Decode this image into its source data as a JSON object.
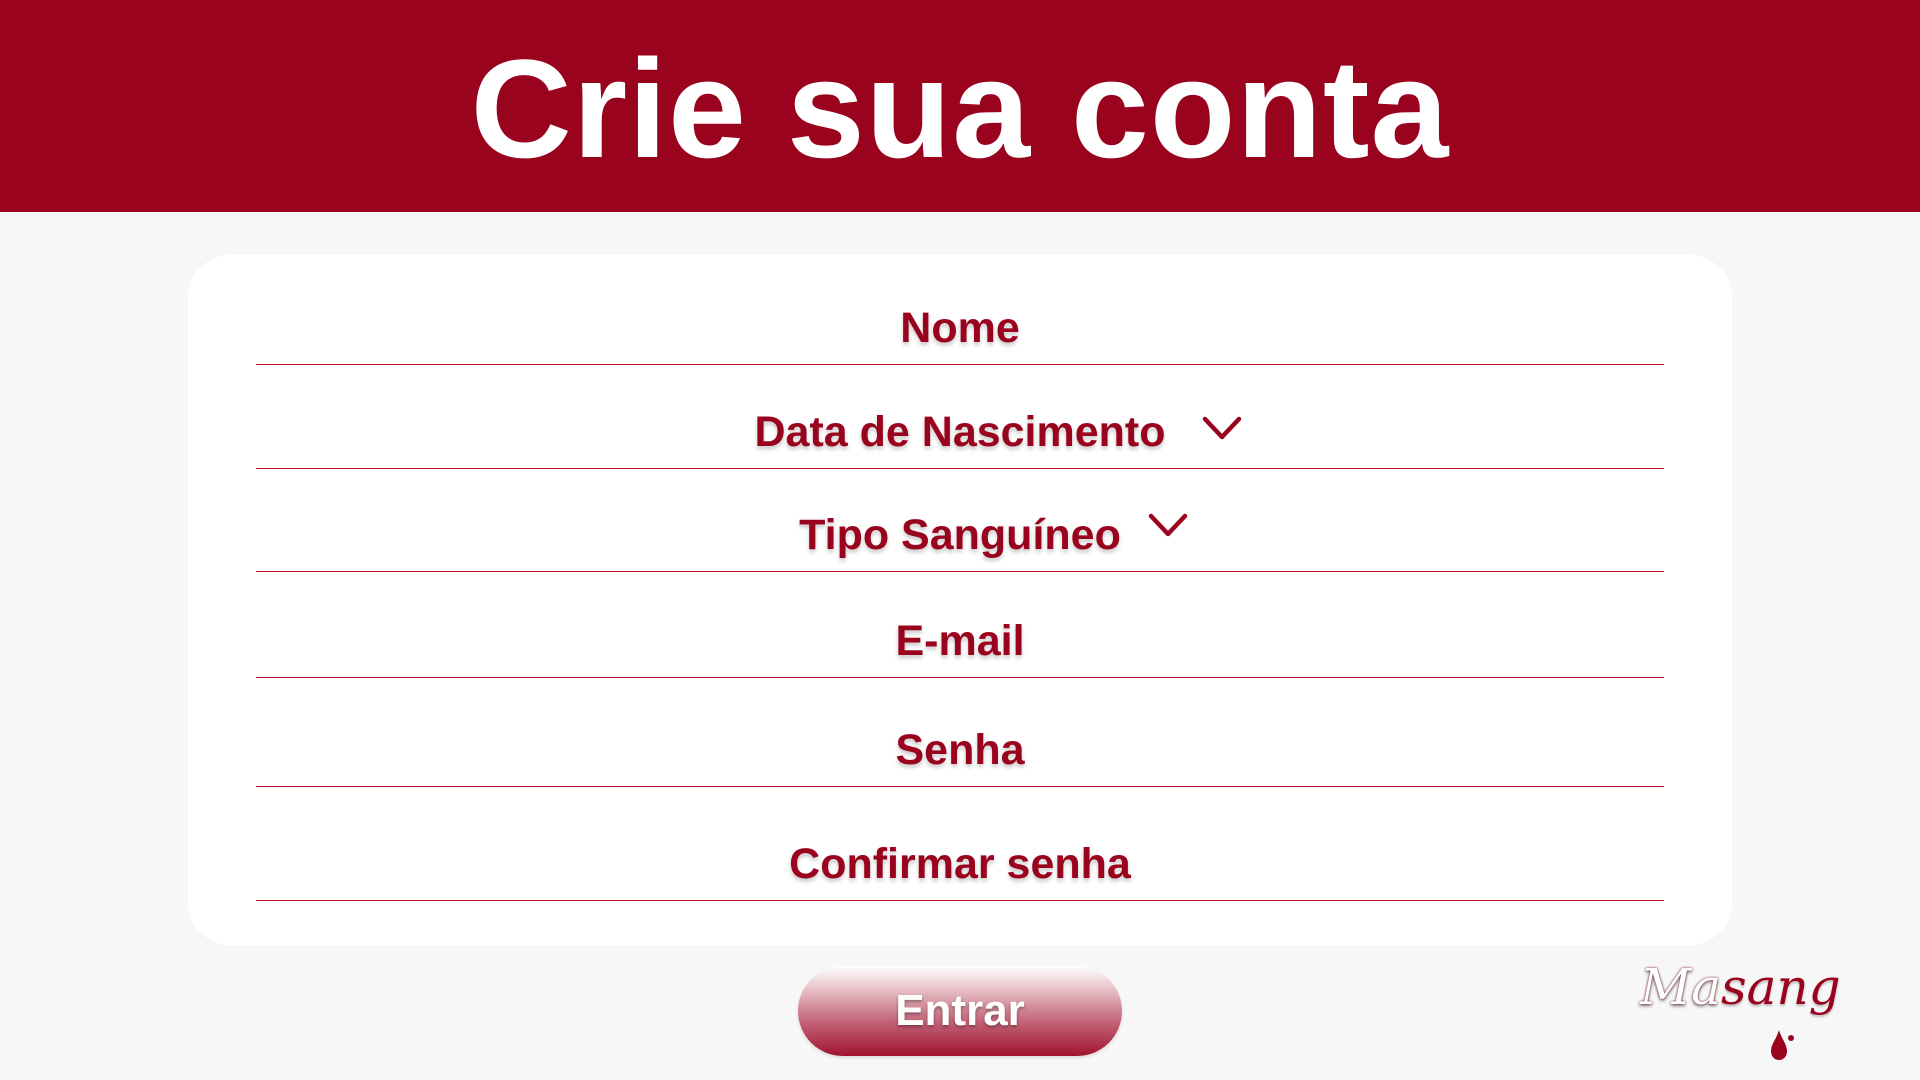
{
  "header": {
    "title": "Crie sua conta"
  },
  "form": {
    "fields": [
      {
        "label": "Nome",
        "type": "text",
        "has_dropdown": false
      },
      {
        "label": "Data de Nascimento",
        "type": "select",
        "has_dropdown": true,
        "icon": "chevron-down-icon"
      },
      {
        "label": "Tipo Sanguíneo",
        "type": "select",
        "has_dropdown": true,
        "icon": "chevron-down-icon"
      },
      {
        "label": "E-mail",
        "type": "email",
        "has_dropdown": false
      },
      {
        "label": "Senha",
        "type": "password",
        "has_dropdown": false
      },
      {
        "label": "Confirmar senha",
        "type": "password",
        "has_dropdown": false
      }
    ]
  },
  "actions": {
    "submit_label": "Entrar"
  },
  "logo": {
    "part1": "Ma",
    "part2": "sang",
    "icon": "blood-drop-icon"
  },
  "colors": {
    "brand": "#9a031e",
    "background": "#f7f7f7",
    "card": "#ffffff",
    "header_text": "#ffffff"
  }
}
